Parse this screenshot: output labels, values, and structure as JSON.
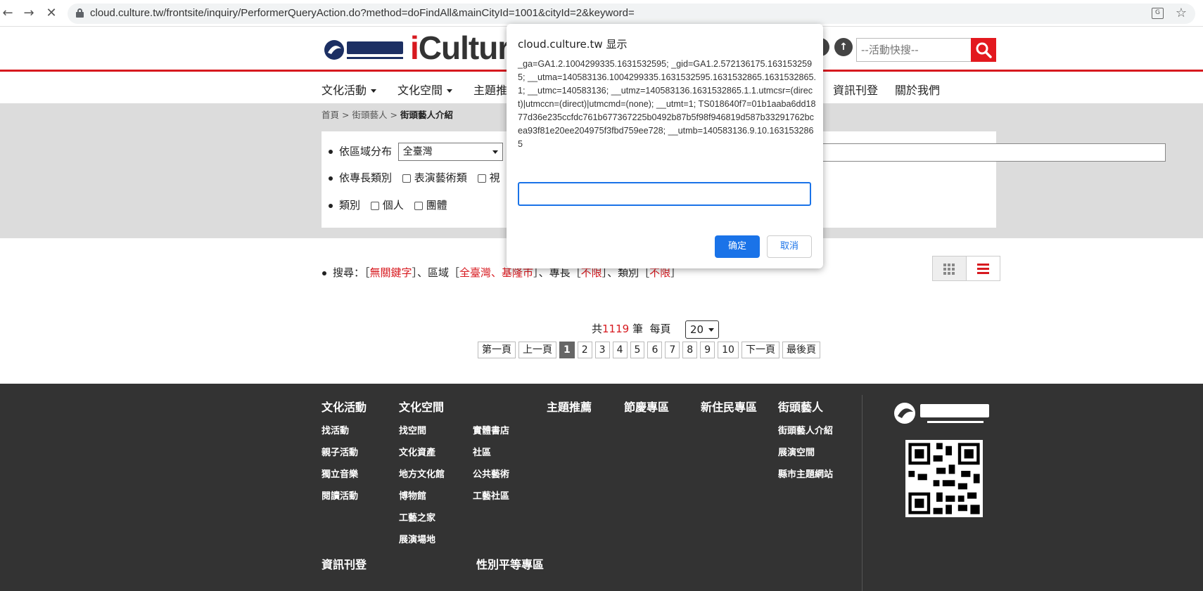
{
  "browser": {
    "url": "cloud.culture.tw/frontsite/inquiry/PerformerQueryAction.do?method=doFindAll&mainCityId=1001&cityId=2&keyword="
  },
  "header": {
    "logo_text": "iCultur",
    "logo_initial": "i",
    "logo_rest": "Cultur",
    "quick_search_placeholder": "--活動快搜--"
  },
  "main_nav": [
    {
      "label": "文化活動",
      "dropdown": true
    },
    {
      "label": "文化空間",
      "dropdown": true
    },
    {
      "label": "主題推",
      "dropdown": false
    },
    {
      "label": "資訊刊登",
      "dropdown": false
    },
    {
      "label": "關於我們",
      "dropdown": false
    }
  ],
  "breadcrumb": {
    "home": "首頁",
    "sep": ">",
    "parent": "街頭藝人",
    "current": "街頭藝人介紹"
  },
  "filters": {
    "region_label": "依區域分布",
    "region_value": "全臺灣",
    "specialty_label": "依專長類別",
    "specialty_options": [
      "表演藝術類",
      "視"
    ],
    "type_label": "類別",
    "type_options": [
      "個人",
      "團體"
    ]
  },
  "search_summary": {
    "prefix": "搜尋：［",
    "keyword": "無關鍵字",
    "region_pre": "］、區域［",
    "region": "全臺灣、基隆市",
    "specialty_pre": "］、專長［",
    "specialty": "不限",
    "type_pre": "］、類別［",
    "type": "不限",
    "suffix": "］"
  },
  "results": {
    "total_prefix": "共",
    "total": "1119",
    "total_suffix": "筆",
    "per_page_label": "每頁",
    "per_page": "20"
  },
  "pager": {
    "first": "第一頁",
    "prev": "上一頁",
    "pages": [
      "1",
      "2",
      "3",
      "4",
      "5",
      "6",
      "7",
      "8",
      "9",
      "10"
    ],
    "active": "1",
    "next": "下一頁",
    "last": "最後頁"
  },
  "footer": {
    "cultural_events": {
      "title": "文化活動",
      "links": [
        "找活動",
        "親子活動",
        "獨立音樂",
        "閱讀活動"
      ]
    },
    "cultural_spaces": {
      "title": "文化空間",
      "links": [
        "找空間",
        "文化資產",
        "地方文化館",
        "博物館",
        "工藝之家",
        "展演場地"
      ],
      "links2": [
        "實體書店",
        "社區",
        "公共藝術",
        "工藝社區"
      ]
    },
    "theme": {
      "title": "主題推薦"
    },
    "festival": {
      "title": "節慶專區"
    },
    "new_residents": {
      "title": "新住民專區"
    },
    "street_artists": {
      "title": "街頭藝人",
      "links": [
        "街頭藝人介紹",
        "展演空間",
        "縣市主題網站"
      ]
    },
    "info_publish": {
      "title": "資訊刊登"
    },
    "gender_equality": {
      "title": "性別平等專區"
    }
  },
  "dialog": {
    "title": "cloud.culture.tw 显示",
    "message": "_ga=GA1.2.1004299335.1631532595; _gid=GA1.2.572136175.1631532595; __utma=140583136.1004299335.1631532595.1631532865.1631532865.1; __utmc=140583136; __utmz=140583136.1631532865.1.1.utmcsr=(direct)|utmccn=(direct)|utmcmd=(none); __utmt=1; TS018640f7=01b1aaba6dd1877d36e235ccfdc761b677367225b0492b87b5f98f946819d587b33291762bcea93f81e20ee204975f3fbd759ee728; __utmb=140583136.9.10.1631532865",
    "input_value": "",
    "ok_label": "确定",
    "cancel_label": "取消"
  },
  "colors": {
    "brand_red": "#d7191f",
    "footer_bg": "#333333",
    "dialog_blue": "#1a73e8"
  }
}
